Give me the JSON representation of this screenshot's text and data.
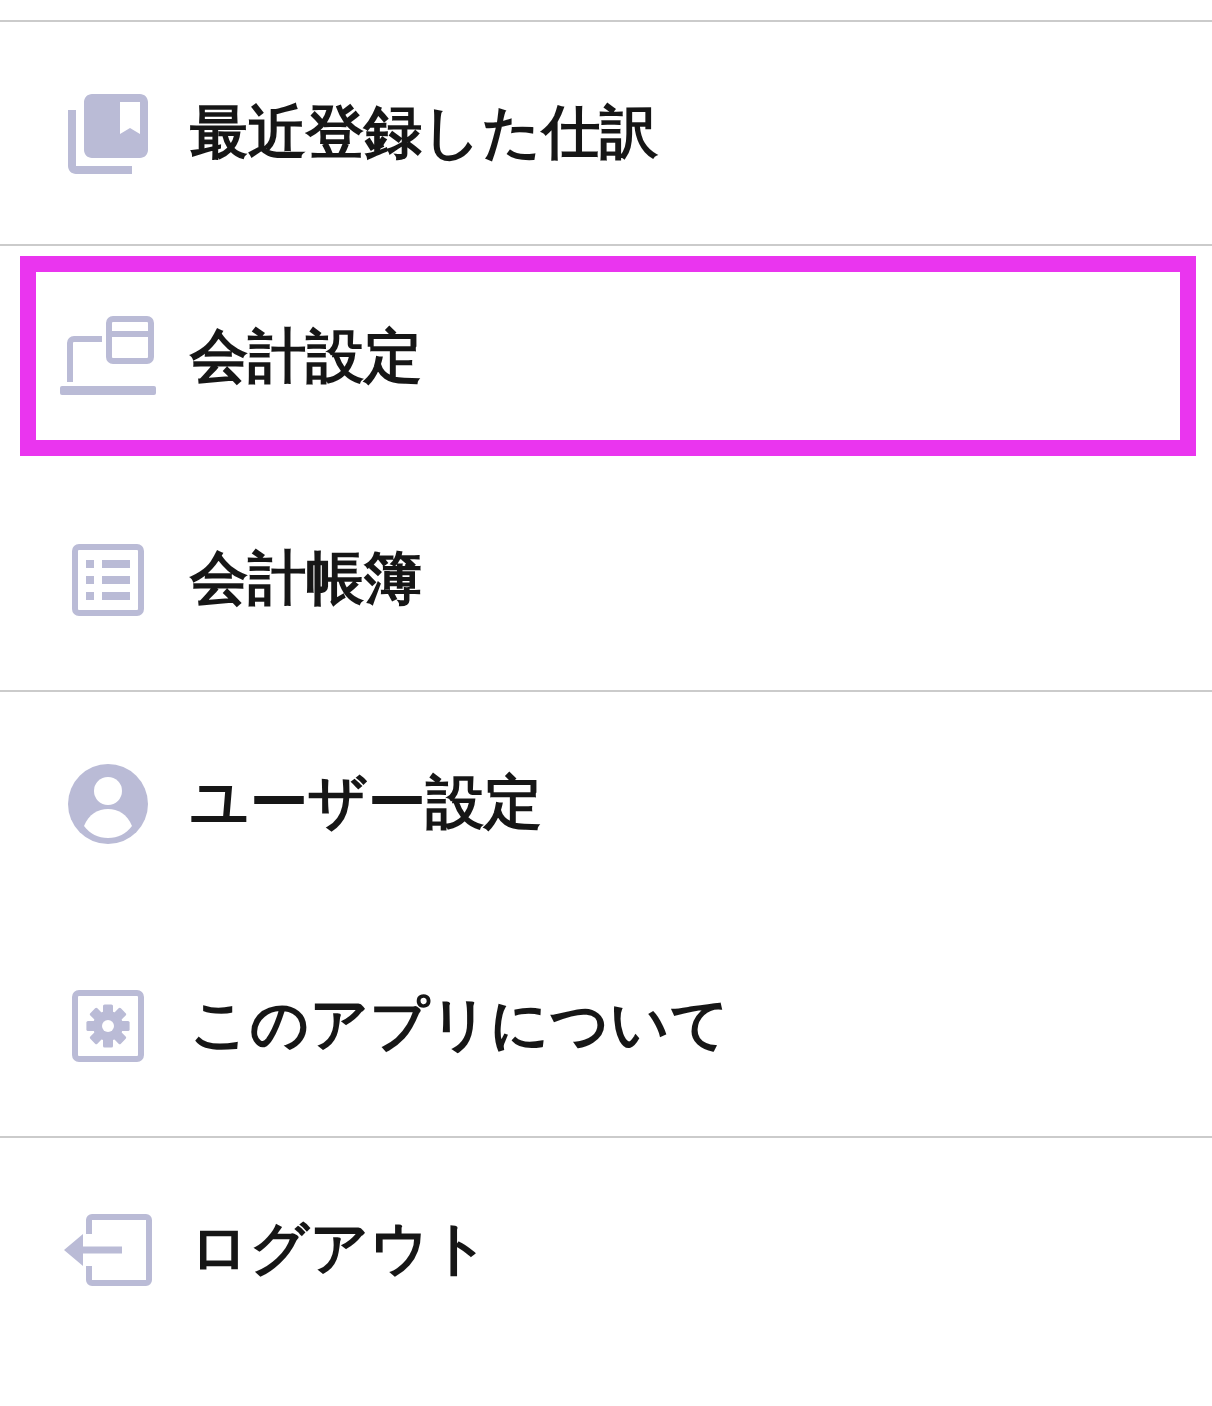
{
  "menu": {
    "sections": [
      {
        "items": [
          {
            "label": "最近登録した仕訳",
            "selected": false
          }
        ]
      },
      {
        "items": [
          {
            "label": "会計設定",
            "selected": true
          },
          {
            "label": "会計帳簿",
            "selected": false
          }
        ]
      },
      {
        "items": [
          {
            "label": "ユーザー設定",
            "selected": false
          },
          {
            "label": "このアプリについて",
            "selected": false
          }
        ]
      },
      {
        "items": [
          {
            "label": "ログアウト",
            "selected": false
          }
        ]
      }
    ]
  }
}
